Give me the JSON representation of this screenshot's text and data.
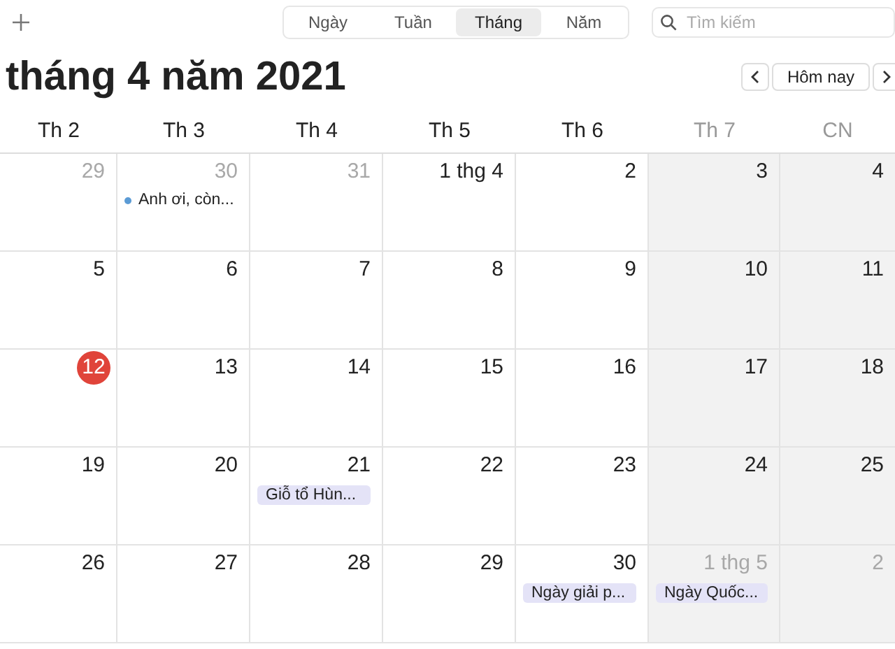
{
  "views": [
    {
      "label": "Ngày",
      "selected": false
    },
    {
      "label": "Tuần",
      "selected": false
    },
    {
      "label": "Tháng",
      "selected": true
    },
    {
      "label": "Năm",
      "selected": false
    }
  ],
  "search": {
    "placeholder": "Tìm kiếm"
  },
  "title": "tháng 4 năm 2021",
  "today_button": "Hôm nay",
  "weekdays": [
    {
      "label": "Th 2",
      "weekend": false
    },
    {
      "label": "Th 3",
      "weekend": false
    },
    {
      "label": "Th 4",
      "weekend": false
    },
    {
      "label": "Th 5",
      "weekend": false
    },
    {
      "label": "Th 6",
      "weekend": false
    },
    {
      "label": "Th 7",
      "weekend": true
    },
    {
      "label": "CN",
      "weekend": true
    }
  ],
  "weeks": [
    {
      "days": [
        {
          "label": "29",
          "in_month": false
        },
        {
          "label": "30",
          "in_month": false,
          "events": [
            {
              "title": "Anh ơi, còn...",
              "kind": "dot",
              "color": "#5b9bd5"
            }
          ]
        },
        {
          "label": "31",
          "in_month": false
        },
        {
          "label": "1 thg 4",
          "in_month": true
        },
        {
          "label": "2",
          "in_month": true
        },
        {
          "label": "3",
          "in_month": true
        },
        {
          "label": "4",
          "in_month": true
        }
      ]
    },
    {
      "days": [
        {
          "label": "5",
          "in_month": true
        },
        {
          "label": "6",
          "in_month": true
        },
        {
          "label": "7",
          "in_month": true
        },
        {
          "label": "8",
          "in_month": true
        },
        {
          "label": "9",
          "in_month": true
        },
        {
          "label": "10",
          "in_month": true
        },
        {
          "label": "11",
          "in_month": true
        }
      ]
    },
    {
      "days": [
        {
          "label": "12",
          "in_month": true,
          "today": true
        },
        {
          "label": "13",
          "in_month": true
        },
        {
          "label": "14",
          "in_month": true
        },
        {
          "label": "15",
          "in_month": true
        },
        {
          "label": "16",
          "in_month": true
        },
        {
          "label": "17",
          "in_month": true
        },
        {
          "label": "18",
          "in_month": true
        }
      ]
    },
    {
      "days": [
        {
          "label": "19",
          "in_month": true
        },
        {
          "label": "20",
          "in_month": true
        },
        {
          "label": "21",
          "in_month": true,
          "events": [
            {
              "title": "Giỗ tổ Hùn...",
              "kind": "block",
              "color": "#e4e3f7"
            }
          ]
        },
        {
          "label": "22",
          "in_month": true
        },
        {
          "label": "23",
          "in_month": true
        },
        {
          "label": "24",
          "in_month": true
        },
        {
          "label": "25",
          "in_month": true
        }
      ]
    },
    {
      "days": [
        {
          "label": "26",
          "in_month": true
        },
        {
          "label": "27",
          "in_month": true
        },
        {
          "label": "28",
          "in_month": true
        },
        {
          "label": "29",
          "in_month": true
        },
        {
          "label": "30",
          "in_month": true,
          "events": [
            {
              "title": "Ngày giải p...",
              "kind": "block",
              "color": "#e4e3f7"
            }
          ]
        },
        {
          "label": "1 thg 5",
          "in_month": false,
          "events": [
            {
              "title": "Ngày Quốc...",
              "kind": "block",
              "color": "#e4e3f7"
            }
          ]
        },
        {
          "label": "2",
          "in_month": false
        }
      ]
    }
  ]
}
